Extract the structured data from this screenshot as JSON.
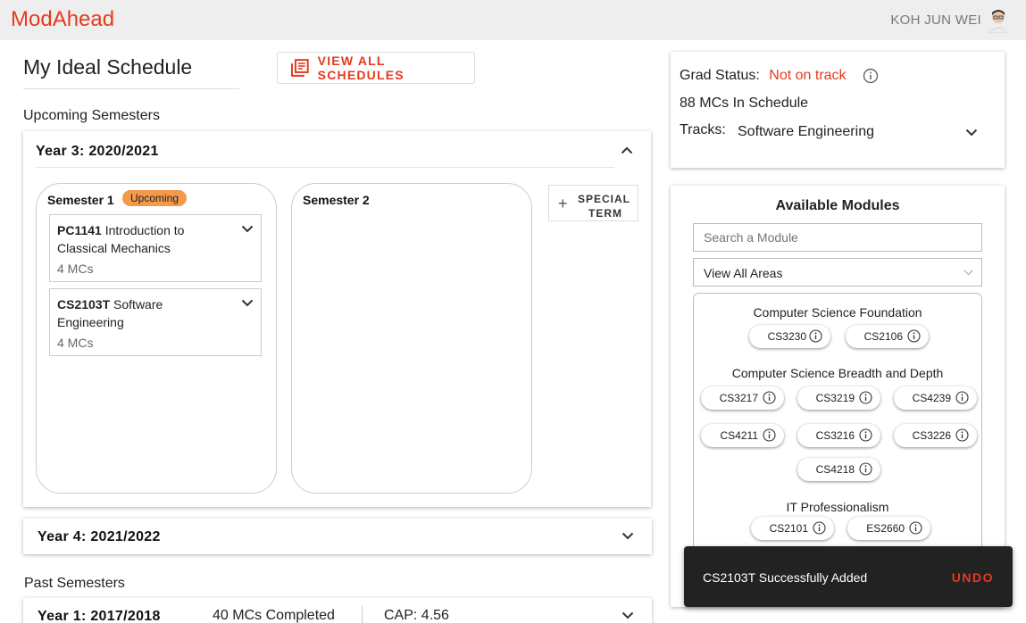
{
  "app": {
    "logo": "ModAhead",
    "user_name": "KOH JUN WEI"
  },
  "page": {
    "title": "My Ideal Schedule",
    "view_all_label": "VIEW ALL SCHEDULES"
  },
  "upcoming": {
    "label": "Upcoming Semesters",
    "year3": {
      "heading": "Year 3: 2020/2021",
      "semester1": {
        "title": "Semester 1",
        "badge": "Upcoming",
        "modules": [
          {
            "code": "PC1141",
            "name": "Introduction to Classical Mechanics",
            "mcs": "4 MCs"
          },
          {
            "code": "CS2103T",
            "name": "Software Engineering",
            "mcs": "4 MCs"
          }
        ]
      },
      "semester2": {
        "title": "Semester 2"
      },
      "special_term": {
        "line1": "SPECIAL",
        "line2": "TERM"
      }
    },
    "year4": {
      "heading": "Year 4: 2021/2022"
    }
  },
  "past": {
    "label": "Past Semesters",
    "year1": {
      "heading": "Year 1: 2017/2018",
      "mcs_completed": "40 MCs Completed",
      "cap": "CAP: 4.56"
    }
  },
  "grad": {
    "status_label": "Grad Status:",
    "status_value": "Not on track",
    "mcs_in_schedule": "88 MCs In Schedule",
    "tracks_label": "Tracks:",
    "track_value": "Software Engineering"
  },
  "available": {
    "title": "Available Modules",
    "search_placeholder": "Search a Module",
    "area_filter": "View All Areas",
    "areas": [
      {
        "name": "Computer Science Foundation",
        "modules": [
          "CS3230",
          "CS2106"
        ]
      },
      {
        "name": "Computer Science Breadth and Depth",
        "modules": [
          "CS3217",
          "CS3219",
          "CS4239",
          "CS4211",
          "CS3216",
          "CS3226",
          "CS4218"
        ]
      },
      {
        "name": "IT Professionalism",
        "modules": [
          "CS2101",
          "ES2660"
        ]
      }
    ]
  },
  "snackbar": {
    "message": "CS2103T Successfully Added",
    "action": "UNDO"
  },
  "colors": {
    "accent": "#e53a1e",
    "badge": "#f2994a",
    "topbar": "#eeeeee",
    "snackbar": "#222222"
  }
}
